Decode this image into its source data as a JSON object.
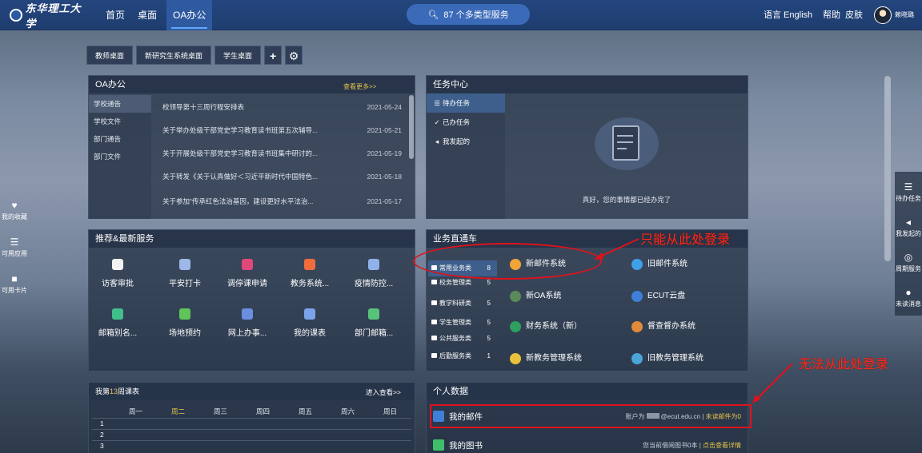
{
  "topbar": {
    "logo_text": "东华理工大学",
    "nav": [
      "首页",
      "桌面",
      "OA办公"
    ],
    "search": "87 个多类型服务",
    "lang": "语言 English",
    "help": "帮助",
    "skin": "皮肤",
    "user": "赖晓璐"
  },
  "desk_tabs": [
    "教师桌面",
    "新研究生系统桌面",
    "学生桌面",
    "+",
    "⚙"
  ],
  "oa": {
    "title": "OA办公",
    "more": "查看更多>>",
    "categories": [
      "学校通告",
      "学校文件",
      "部门通告",
      "部门文件"
    ],
    "items": [
      {
        "title": "校领导第十三周行程安排表",
        "date": "2021-05-24"
      },
      {
        "title": "关于举办处级干部党史学习教育读书班第五次辅导...",
        "date": "2021-05-21"
      },
      {
        "title": "关于开展处级干部党史学习教育读书班集中研讨的...",
        "date": "2021-05-19"
      },
      {
        "title": "关于转发《关于认真做好＜习近平新时代中国特色...",
        "date": "2021-05-18"
      },
      {
        "title": "关于参加“传承红色法治基因，建设更好水平法治...",
        "date": "2021-05-17"
      }
    ]
  },
  "task": {
    "title": "任务中心",
    "tabs": [
      {
        "icon": "☰",
        "label": "待办任务"
      },
      {
        "icon": "✓",
        "label": "已办任务"
      },
      {
        "icon": "◂",
        "label": "我发起的"
      }
    ],
    "message": "真好，您的事情都已经办完了"
  },
  "recommend": {
    "title": "推荐&最新服务",
    "apps": [
      {
        "label": "访客审批",
        "color": "#f2f2f2"
      },
      {
        "label": "平安打卡",
        "color": "#9db7e8"
      },
      {
        "label": "调停课申请",
        "color": "#e0487a"
      },
      {
        "label": "教务系统...",
        "color": "#f06c3c"
      },
      {
        "label": "疫情防控...",
        "color": "#8fb2ea"
      },
      {
        "label": "邮箱别名...",
        "color": "#3fbf8a"
      },
      {
        "label": "场地预约",
        "color": "#5fc45a"
      },
      {
        "label": "网上办事...",
        "color": "#6a8fe0"
      },
      {
        "label": "我的课表",
        "color": "#7aa3ea"
      },
      {
        "label": "部门邮箱...",
        "color": "#58c27a"
      }
    ]
  },
  "business": {
    "title": "业务直通车",
    "categories": [
      {
        "label": "常用业务类",
        "count": "8"
      },
      {
        "label": "校务管理类",
        "count": "5"
      },
      {
        "label": "教学科研类",
        "count": "5"
      },
      {
        "label": "学生管理类",
        "count": "5"
      },
      {
        "label": "公共服务类",
        "count": "5"
      },
      {
        "label": "后勤服务类",
        "count": "1"
      }
    ],
    "systems": [
      {
        "label": "新邮件系统",
        "color": "#f0a437"
      },
      {
        "label": "旧邮件系统",
        "color": "#3fa0e8"
      },
      {
        "label": "新OA系统",
        "color": "#5a8a5a"
      },
      {
        "label": "ECUT云盘",
        "color": "#3f7fd8"
      },
      {
        "label": "财务系统（新）",
        "color": "#2e9f5e"
      },
      {
        "label": "督查督办系统",
        "color": "#e08a3a"
      },
      {
        "label": "新教务管理系统",
        "color": "#e8c23a"
      },
      {
        "label": "旧教务管理系统",
        "color": "#4aa6d8"
      }
    ]
  },
  "schedule": {
    "title_prefix": "我第",
    "week": "13",
    "title_suffix": "周课表",
    "more": "进入查看>>",
    "days": [
      "周一",
      "周二",
      "周三",
      "周四",
      "周五",
      "周六",
      "周日"
    ],
    "rows": [
      "1",
      "2",
      "3"
    ]
  },
  "personal": {
    "title": "个人数据",
    "mail": {
      "label": "我的邮件",
      "account": "账户为",
      "domain": "@ecut.edu.cn",
      "sep": "|",
      "unread": "未读邮件为0"
    },
    "books": {
      "label": "我的图书",
      "info": "您当前借阅图书0本",
      "sep": "|",
      "link": "点击查看详情"
    }
  },
  "left_bar": [
    {
      "icon": "♥",
      "label": "我的收藏"
    },
    {
      "icon": "☰",
      "label": "可用应用"
    },
    {
      "icon": "■",
      "label": "可用卡片"
    }
  ],
  "right_bar": [
    {
      "icon": "☰",
      "label": "待办任务"
    },
    {
      "icon": "◂",
      "label": "我发起的"
    },
    {
      "icon": "◎",
      "label": "周期服务"
    },
    {
      "icon": "●",
      "label": "未读消息"
    }
  ],
  "annotations": {
    "top": "只能从此处登录",
    "bottom": "无法从此处登录"
  },
  "colors": {
    "topbar": "#1e3d70",
    "accent": "#3e5f8c",
    "link": "#e6c34a",
    "annotation": "#e0121b"
  }
}
